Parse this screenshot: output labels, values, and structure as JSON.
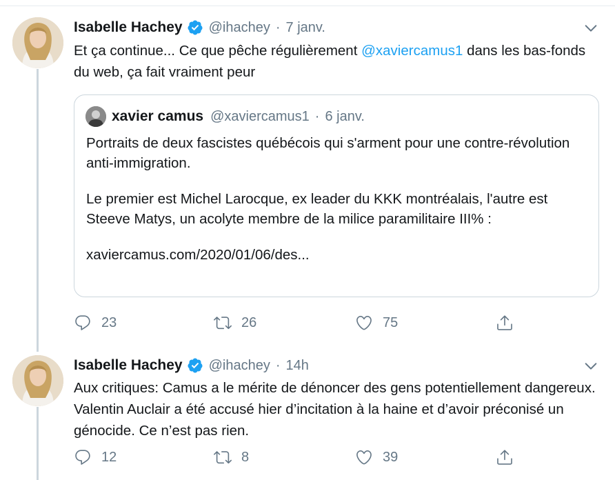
{
  "tweets": [
    {
      "author_name": "Isabelle Hachey",
      "handle": "@ihachey",
      "separator": "·",
      "time": "7 janv.",
      "text_before": "Et ça continue...  Ce que pêche régulièrement ",
      "mention": "@xaviercamus1",
      "text_after": " dans les bas-fonds du web, ça fait vraiment peur",
      "quote": {
        "author_name": "xavier camus",
        "handle": "@xaviercamus1",
        "separator": "·",
        "time": "6 janv.",
        "paragraphs": [
          "Portraits de deux fascistes québécois qui s'arment pour une contre-révolution anti-immigration.",
          "Le premier est Michel Larocque, ex leader du KKK montréalais, l'autre est Steeve Matys, un acolyte membre de la milice paramilitaire III% :",
          "xaviercamus.com/2020/01/06/des..."
        ]
      },
      "replies": "23",
      "retweets": "26",
      "likes": "75"
    },
    {
      "author_name": "Isabelle Hachey",
      "handle": "@ihachey",
      "separator": "·",
      "time": "14h",
      "text": "Aux critiques: Camus a le mérite de dénoncer des gens potentiellement dangereux. Valentin Auclair a été accusé hier d’incitation à la haine et d’avoir préconisé un génocide. Ce n’est pas rien.",
      "replies": "12",
      "retweets": "8",
      "likes": "39"
    }
  ],
  "icons": {
    "verified": "verified-badge-icon",
    "caret": "chevron-down-icon",
    "reply": "reply-icon",
    "retweet": "retweet-icon",
    "like": "heart-icon",
    "share": "share-icon"
  },
  "colors": {
    "accent": "#1da1f2",
    "secondary_text": "#657786",
    "border": "#ccd6dd"
  }
}
